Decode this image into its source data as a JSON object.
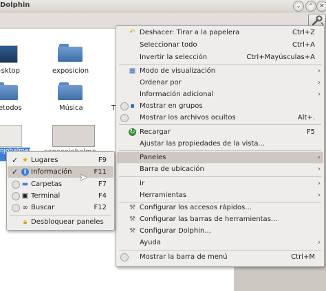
{
  "window": {
    "title": "Dolphin"
  },
  "files": [
    {
      "label": "-sktop"
    },
    {
      "label": "exposicion"
    },
    {
      "label": "etodos"
    },
    {
      "label": "Música"
    },
    {
      "label": "T"
    },
    {
      "label": "ojohalmer"
    },
    {
      "label": "capceojohalme"
    }
  ],
  "main_menu": [
    {
      "label": "Deshacer: Tirar a la papelera",
      "shortcut": "Ctrl+Z",
      "icon": "undo-icon"
    },
    {
      "label": "Seleccionar todo",
      "shortcut": "Ctrl+A"
    },
    {
      "label": "Invertir la selección",
      "shortcut": "Ctrl+Mayúsculas+A"
    },
    {
      "label": "Modo de visualización",
      "submenu": true,
      "icon": "view-mode-icon"
    },
    {
      "label": "Ordenar por",
      "submenu": true
    },
    {
      "label": "Información adicional",
      "submenu": true
    },
    {
      "label": "Mostrar en grupos",
      "checkbox": true,
      "icon": "groups-icon"
    },
    {
      "label": "Mostrar los archivos ocultos",
      "shortcut": "Alt+.",
      "checkbox": true
    },
    {
      "label": "Recargar",
      "shortcut": "F5",
      "icon": "reload-icon"
    },
    {
      "label": "Ajustar las propiedades de la vista..."
    },
    {
      "label": "Paneles",
      "submenu": true,
      "highlighted": true
    },
    {
      "label": "Barra de ubicación",
      "submenu": true
    },
    {
      "label": "Ir",
      "submenu": true
    },
    {
      "label": "Herramientas",
      "submenu": true
    },
    {
      "label": "Configurar los accesos rápidos...",
      "icon": "configure-icon"
    },
    {
      "label": "Configurar las barras de herramientas...",
      "icon": "configure-icon"
    },
    {
      "label": "Configurar Dolphin...",
      "icon": "configure-icon"
    },
    {
      "label": "Ayuda",
      "submenu": true
    },
    {
      "label": "Mostrar la barra de menú",
      "shortcut": "Ctrl+M",
      "checkbox": true
    }
  ],
  "panels_menu": [
    {
      "label": "Lugares",
      "shortcut": "F9",
      "checked": true,
      "icon": "places-icon"
    },
    {
      "label": "Información",
      "shortcut": "F11",
      "checked": true,
      "icon": "info-icon",
      "highlighted": true
    },
    {
      "label": "Carpetas",
      "shortcut": "F7",
      "icon": "folders-icon"
    },
    {
      "label": "Terminal",
      "shortcut": "F4",
      "icon": "terminal-icon"
    },
    {
      "label": "Buscar",
      "shortcut": "F12",
      "icon": "search-icon"
    },
    {
      "label": "Desbloquear paneles",
      "icon": "lock-icon"
    }
  ]
}
